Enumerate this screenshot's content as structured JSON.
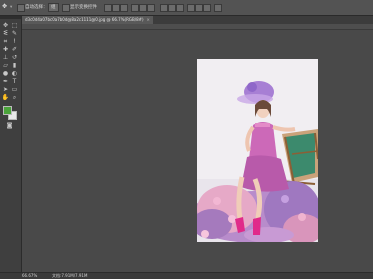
{
  "options_bar": {
    "tool_label": "自动选择：",
    "group_value": "组",
    "transform_label": "显示变换控件"
  },
  "document_tab": {
    "title": "d3c0d4a07bc0a7b0d@8a2c1111@0.jpg @ 66.7%(RGB/8#)",
    "close_glyph": "×"
  },
  "status": {
    "zoom": "66.67%",
    "doc_info": "文档:7.91M/7.91M"
  },
  "colors": {
    "foreground": "#4aa33a",
    "background": "#e9e9e9",
    "photo_backdrop": "#f1eef2"
  },
  "tools": [
    {
      "name": "move-tool-icon",
      "glyph": "✥"
    },
    {
      "name": "marquee-tool-icon",
      "glyph": "⬚"
    },
    {
      "name": "lasso-tool-icon",
      "glyph": "ᓬ"
    },
    {
      "name": "quick-select-tool-icon",
      "glyph": "✎"
    },
    {
      "name": "crop-tool-icon",
      "glyph": "⌗"
    },
    {
      "name": "eyedropper-tool-icon",
      "glyph": "ⵑ"
    },
    {
      "name": "healing-brush-tool-icon",
      "glyph": "✚"
    },
    {
      "name": "brush-tool-icon",
      "glyph": "✐"
    },
    {
      "name": "clone-stamp-tool-icon",
      "glyph": "⊥"
    },
    {
      "name": "history-brush-tool-icon",
      "glyph": "↺"
    },
    {
      "name": "eraser-tool-icon",
      "glyph": "▱"
    },
    {
      "name": "gradient-tool-icon",
      "glyph": "▮"
    },
    {
      "name": "blur-tool-icon",
      "glyph": "●"
    },
    {
      "name": "dodge-tool-icon",
      "glyph": "◐"
    },
    {
      "name": "pen-tool-icon",
      "glyph": "✒"
    },
    {
      "name": "type-tool-icon",
      "glyph": "T"
    },
    {
      "name": "path-select-tool-icon",
      "glyph": "➤"
    },
    {
      "name": "shape-tool-icon",
      "glyph": "▭"
    },
    {
      "name": "hand-tool-icon",
      "glyph": "✋"
    },
    {
      "name": "zoom-tool-icon",
      "glyph": "⌕"
    }
  ]
}
